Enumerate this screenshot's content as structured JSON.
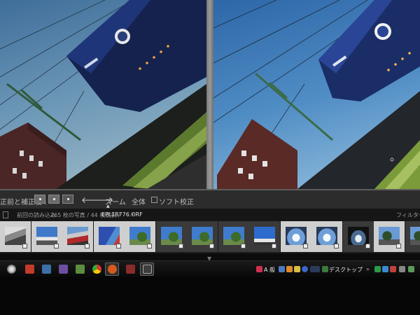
{
  "toolbar": {
    "compare_label": "正前と補正後 :",
    "zoom_label": "ズーム",
    "whole_label": "全体",
    "soft_proof_label": "ソフト校正"
  },
  "infobar": {
    "import_label": "前回の読み込み",
    "photo_count": "265 枚の写真 / 44 枚選択 /",
    "filename": "EPL18776.ORF",
    "filter_label": "フィルター"
  },
  "filmstrip": {
    "thumbs": [
      {
        "kind": "white",
        "scene": "building"
      },
      {
        "kind": "white",
        "scene": "sky"
      },
      {
        "kind": "white",
        "scene": "train-red"
      },
      {
        "kind": "white",
        "scene": "train-blue"
      },
      {
        "kind": "white",
        "scene": "tree-sky"
      },
      {
        "kind": "dark",
        "scene": "tree-sky"
      },
      {
        "kind": "dark",
        "scene": "tree-sky"
      },
      {
        "kind": "dark",
        "scene": "tree-sky"
      },
      {
        "kind": "dark",
        "scene": "sky-house"
      },
      {
        "kind": "white",
        "scene": "fountain"
      },
      {
        "kind": "white",
        "scene": "fountain"
      },
      {
        "kind": "dark",
        "scene": "fountain-dark"
      },
      {
        "kind": "white",
        "scene": "trees"
      },
      {
        "kind": "dark",
        "scene": "trees"
      }
    ]
  },
  "taskbar": {
    "ime_label": "A 般",
    "desktop_label": "デスクトップ"
  },
  "colors": {
    "accent": "#6a8fc0",
    "sky_top": "#4a76a8",
    "train_blue": "#1c2f6e"
  }
}
